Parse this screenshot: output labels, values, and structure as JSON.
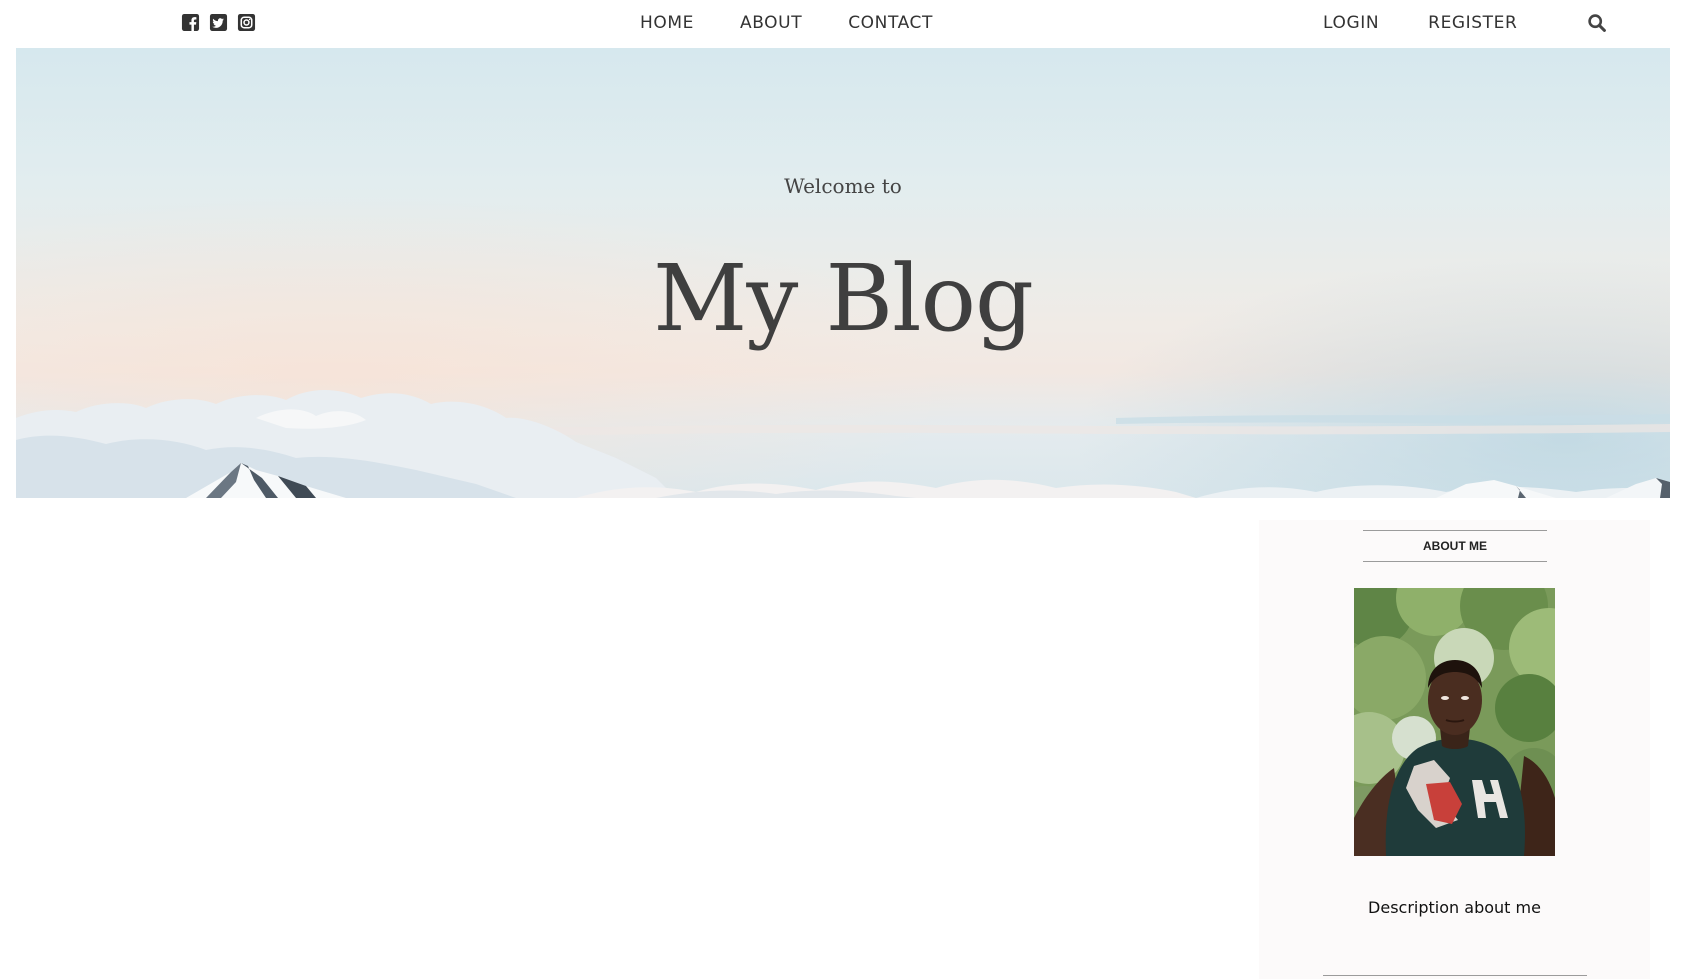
{
  "social": {
    "items": [
      {
        "name": "facebook",
        "icon": "facebook-square-icon"
      },
      {
        "name": "twitter",
        "icon": "twitter-square-icon"
      },
      {
        "name": "instagram",
        "icon": "instagram-icon"
      }
    ],
    "icon_color": "#333333"
  },
  "nav": {
    "home": "HOME",
    "about": "ABOUT",
    "contact": "CONTACT",
    "login": "LOGIN",
    "register": "REGISTER",
    "search_icon": "search-icon"
  },
  "hero": {
    "kicker": "Welcome to",
    "title": "My Blog"
  },
  "sidebar": {
    "about_heading": "ABOUT ME",
    "avatar_icon": "profile-photo",
    "description": "Description about me"
  },
  "colors": {
    "text": "#333333",
    "sidebar_bg": "#fcfafa",
    "divider": "#9b9b9b"
  }
}
